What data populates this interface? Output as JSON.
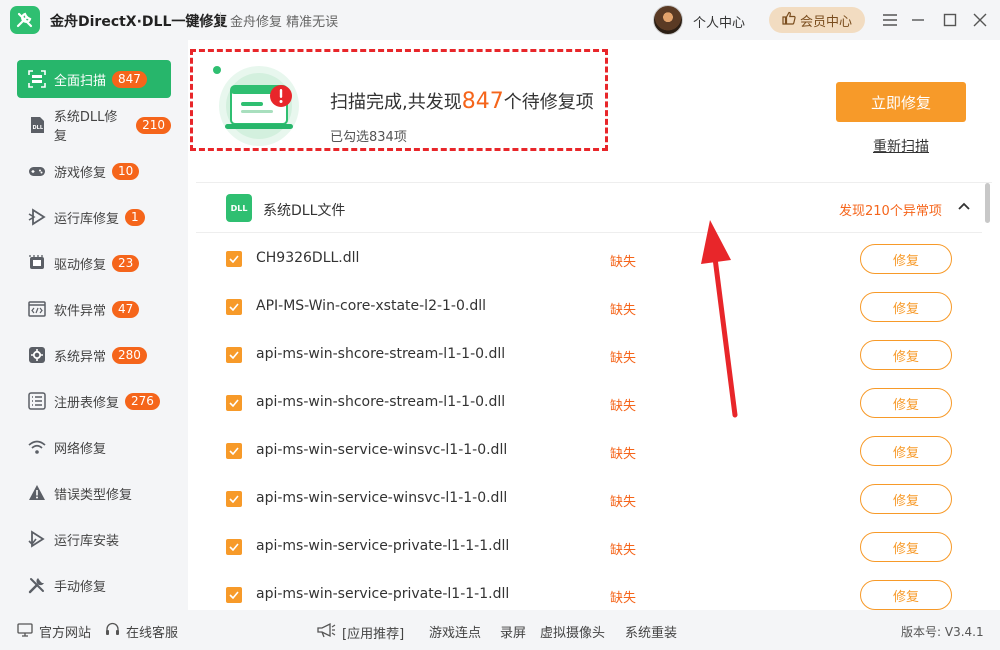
{
  "app": {
    "title": "金舟DirectX·DLL一键修复",
    "slogan": "金舟修复 精准无误",
    "personal_center": "个人中心",
    "vip_center": "会员中心"
  },
  "sidebar": {
    "items": [
      {
        "label": "全面扫描",
        "badge": "847",
        "icon": "scan-icon"
      },
      {
        "label": "系统DLL修复",
        "badge": "210",
        "icon": "dll-icon"
      },
      {
        "label": "游戏修复",
        "badge": "10",
        "icon": "gamepad-icon"
      },
      {
        "label": "运行库修复",
        "badge": "1",
        "icon": "runtime-icon"
      },
      {
        "label": "驱动修复",
        "badge": "23",
        "icon": "driver-icon"
      },
      {
        "label": "软件异常",
        "badge": "47",
        "icon": "code-icon"
      },
      {
        "label": "系统异常",
        "badge": "280",
        "icon": "gear-icon"
      },
      {
        "label": "注册表修复",
        "badge": "276",
        "icon": "list-icon"
      },
      {
        "label": "网络修复",
        "badge": "",
        "icon": "wifi-icon"
      },
      {
        "label": "错误类型修复",
        "badge": "",
        "icon": "warning-icon"
      },
      {
        "label": "运行库安装",
        "badge": "",
        "icon": "install-icon"
      },
      {
        "label": "手动修复",
        "badge": "",
        "icon": "wrench-icon"
      }
    ]
  },
  "summary": {
    "title_prefix": "扫描完成,共发现",
    "count": "847",
    "title_suffix": "个待修复项",
    "selected": "已勾选834项",
    "fix_now": "立即修复",
    "rescan": "重新扫描"
  },
  "section": {
    "icon_text": "DLL",
    "title": "系统DLL文件",
    "count_text": "发现210个异常项"
  },
  "rows": [
    {
      "name": "CH9326DLL.dll",
      "status": "缺失",
      "action": "修复"
    },
    {
      "name": "API-MS-Win-core-xstate-l2-1-0.dll",
      "status": "缺失",
      "action": "修复"
    },
    {
      "name": "api-ms-win-shcore-stream-l1-1-0.dll",
      "status": "缺失",
      "action": "修复"
    },
    {
      "name": "api-ms-win-shcore-stream-l1-1-0.dll",
      "status": "缺失",
      "action": "修复"
    },
    {
      "name": "api-ms-win-service-winsvc-l1-1-0.dll",
      "status": "缺失",
      "action": "修复"
    },
    {
      "name": "api-ms-win-service-winsvc-l1-1-0.dll",
      "status": "缺失",
      "action": "修复"
    },
    {
      "name": "api-ms-win-service-private-l1-1-1.dll",
      "status": "缺失",
      "action": "修复"
    },
    {
      "name": "api-ms-win-service-private-l1-1-1.dll",
      "status": "缺失",
      "action": "修复"
    }
  ],
  "footer": {
    "website": "官方网站",
    "service": "在线客服",
    "recommend": "[应用推荐]",
    "links": [
      "游戏连点",
      "录屏",
      "虚拟摄像头",
      "系统重装"
    ],
    "version": "版本号: V3.4.1"
  },
  "colors": {
    "brand_green": "#27b66b",
    "accent_orange": "#f79a29",
    "badge_orange": "#f5651b",
    "highlight_red": "#e8262a"
  }
}
